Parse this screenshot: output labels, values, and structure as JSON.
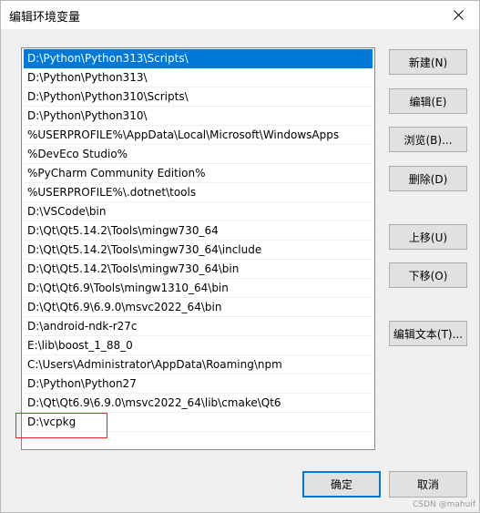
{
  "window": {
    "title": "编辑环境变量"
  },
  "path_list": {
    "selected_index": 0,
    "items": [
      "D:\\Python\\Python313\\Scripts\\",
      "D:\\Python\\Python313\\",
      "D:\\Python\\Python310\\Scripts\\",
      "D:\\Python\\Python310\\",
      "%USERPROFILE%\\AppData\\Local\\Microsoft\\WindowsApps",
      "%DevEco Studio%",
      "%PyCharm Community Edition%",
      "%USERPROFILE%\\.dotnet\\tools",
      "D:\\VSCode\\bin",
      "D:\\Qt\\Qt5.14.2\\Tools\\mingw730_64",
      "D:\\Qt\\Qt5.14.2\\Tools\\mingw730_64\\include",
      "D:\\Qt\\Qt5.14.2\\Tools\\mingw730_64\\bin",
      "D:\\Qt\\Qt6.9\\Tools\\mingw1310_64\\bin",
      "D:\\Qt\\Qt6.9\\6.9.0\\msvc2022_64\\bin",
      "D:\\android-ndk-r27c",
      "E:\\lib\\boost_1_88_0",
      "C:\\Users\\Administrator\\AppData\\Roaming\\npm",
      "D:\\Python\\Python27",
      "D:\\Qt\\Qt6.9\\6.9.0\\msvc2022_64\\lib\\cmake\\Qt6",
      "D:\\vcpkg"
    ]
  },
  "buttons": {
    "new": "新建(N)",
    "edit": "编辑(E)",
    "browse": "浏览(B)...",
    "delete": "删除(D)",
    "move_up": "上移(U)",
    "move_down": "下移(O)",
    "edit_text": "编辑文本(T)...",
    "ok": "确定",
    "cancel": "取消"
  },
  "watermark": "CSDN @mahuif",
  "colors": {
    "selection": "#0078d7",
    "highlight": "#e8232a"
  }
}
